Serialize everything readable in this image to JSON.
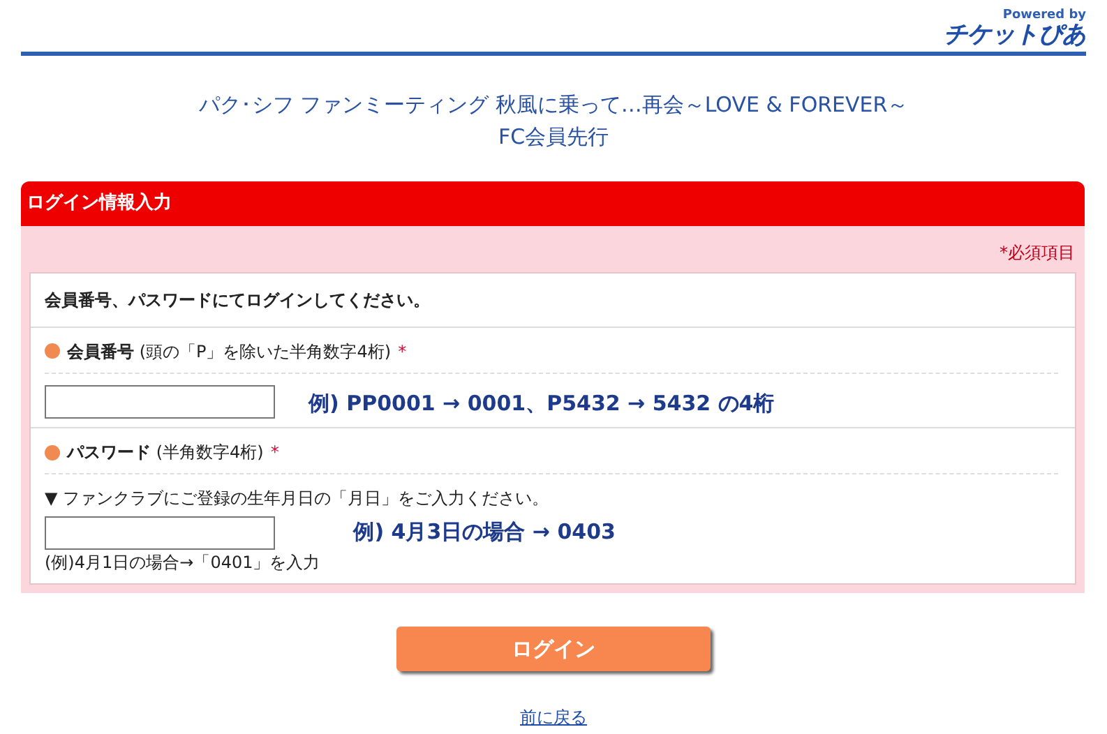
{
  "header": {
    "powered_by": "Powered by",
    "logo": "チケットぴあ"
  },
  "title": {
    "lines": [
      "パク･シフ ファンミーティング 秋風に乗って…再会～LOVE & FOREVER～",
      "FC会員先行"
    ]
  },
  "panel": {
    "heading": "ログイン情報入力",
    "required_note": "*必須項目",
    "instruction": "会員番号、パスワードにてログインしてください。",
    "fields": [
      {
        "label": "**会員番号** (頭の「P」を除いた半角数字4桁)",
        "required_mark": "*",
        "example": "例) PP0001 → 0001、P5432 → 5432 の4桁"
      },
      {
        "label": "**パスワード** (半角数字4桁)",
        "required_mark": "*",
        "hint": "▼ ファンクラブにご登録の生年月日の「月日」をご入力ください。",
        "note": "(例)4月1日の場合→「0401」を入力",
        "example": "例)  4月3日の場合  →  0403"
      }
    ]
  },
  "login_button": "ログイン",
  "back_link": "前に戻る"
}
